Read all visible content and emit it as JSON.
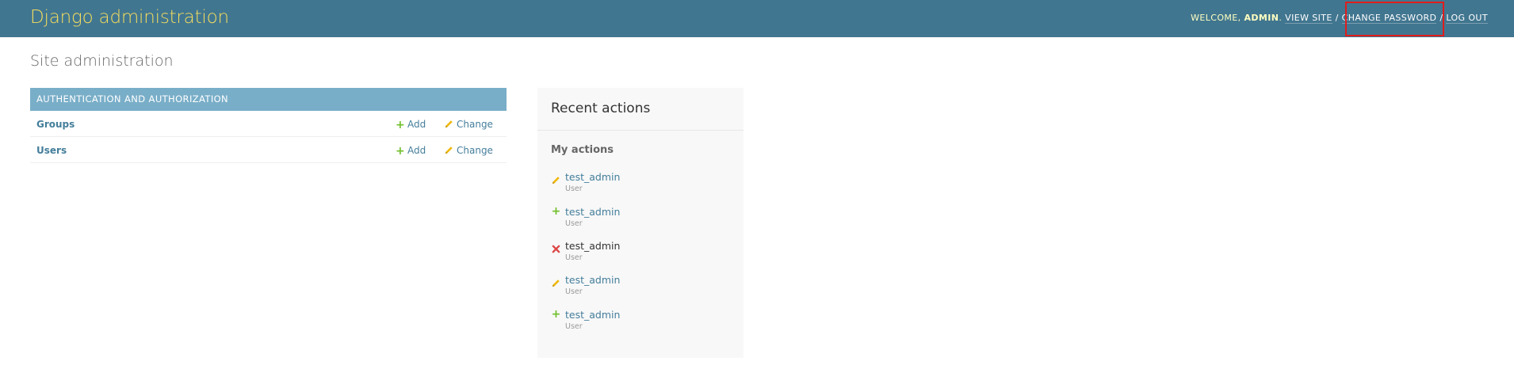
{
  "header": {
    "branding": "Django administration",
    "welcome": "Welcome,",
    "username": "admin",
    "view_site": "View site",
    "change_password": "Change password",
    "log_out": "Log out",
    "separator": "/",
    "highlight_color": "#e11d1d"
  },
  "page_title": "Site administration",
  "app": {
    "caption": "Authentication and Authorization",
    "models": [
      {
        "name": "Groups",
        "add_label": "Add",
        "change_label": "Change"
      },
      {
        "name": "Users",
        "add_label": "Add",
        "change_label": "Change"
      }
    ]
  },
  "recent": {
    "title": "Recent actions",
    "subtitle": "My actions",
    "items": [
      {
        "icon": "pencil-icon",
        "name": "test_admin",
        "type": "User"
      },
      {
        "icon": "plus-icon",
        "name": "test_admin",
        "type": "User"
      },
      {
        "icon": "x-icon",
        "name": "test_admin",
        "type": "User"
      },
      {
        "icon": "pencil-icon",
        "name": "test_admin",
        "type": "User"
      },
      {
        "icon": "plus-icon",
        "name": "test_admin",
        "type": "User"
      }
    ]
  },
  "colors": {
    "header_bg": "#417690",
    "branding": "#f5dd5d",
    "caption_bg": "#79aec8",
    "link": "#447e9b",
    "add_green": "#70bf2b",
    "change_yellow": "#efb80b",
    "delete_red": "#dd4646"
  }
}
